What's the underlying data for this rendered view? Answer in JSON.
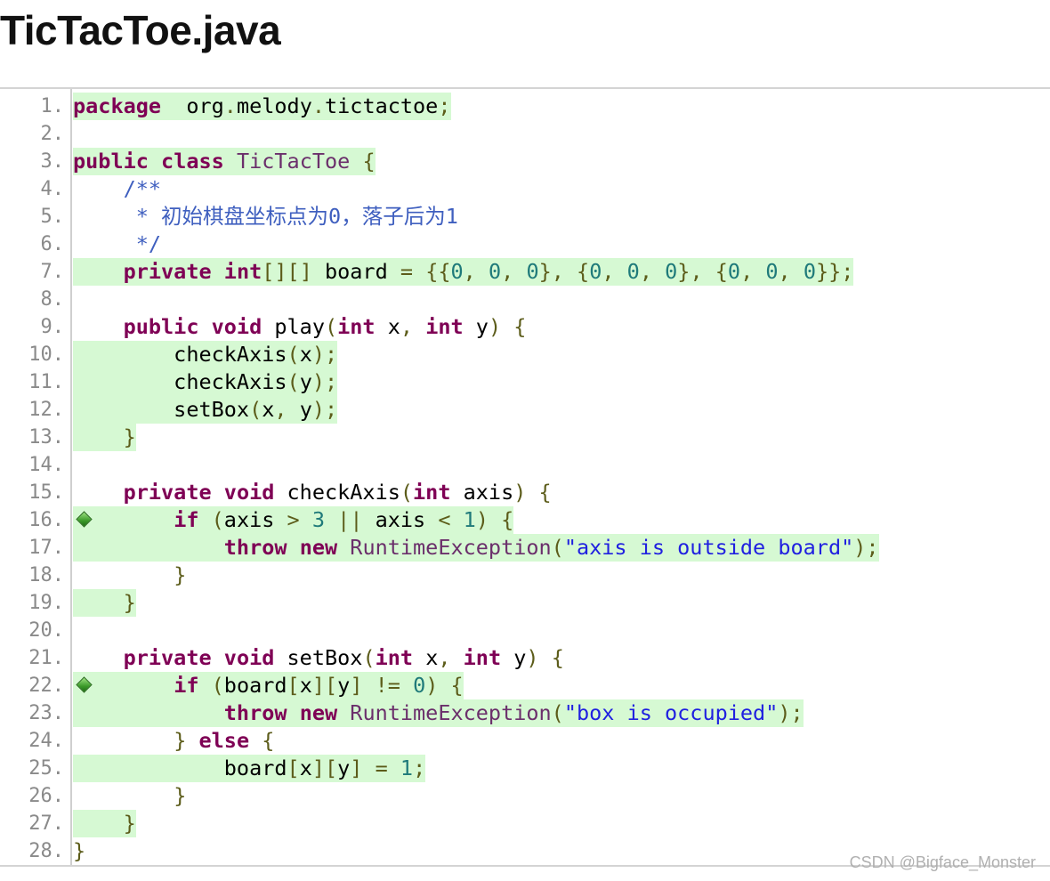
{
  "title": "TicTacToe.java",
  "watermark": "CSDN @Bigface_Monster",
  "colors": {
    "keyword": "#7f0055",
    "punct": "#5c5c1a",
    "string": "#2020e0",
    "number": "#1f7a7a",
    "comment": "#3f5fbf",
    "hit_background": "#d6f9d3",
    "line_number": "#8a8a8a"
  },
  "lines": [
    {
      "n": "1.",
      "hit": true,
      "icon": null,
      "tokens": [
        [
          "kw",
          "package"
        ],
        [
          "",
          "  org"
        ],
        [
          "dot",
          "."
        ],
        [
          "",
          "melody"
        ],
        [
          "dot",
          "."
        ],
        [
          "",
          "tictactoe"
        ],
        [
          "pun",
          ";"
        ]
      ]
    },
    {
      "n": "2.",
      "hit": false,
      "icon": null,
      "tokens": []
    },
    {
      "n": "3.",
      "hit": true,
      "icon": null,
      "tokens": [
        [
          "kw",
          "public"
        ],
        [
          "",
          " "
        ],
        [
          "kw",
          "class"
        ],
        [
          "",
          " "
        ],
        [
          "cls",
          "TicTacToe"
        ],
        [
          "",
          " "
        ],
        [
          "pun",
          "{"
        ]
      ]
    },
    {
      "n": "4.",
      "hit": false,
      "icon": null,
      "tokens": [
        [
          "",
          "    "
        ],
        [
          "cmt",
          "/**"
        ]
      ]
    },
    {
      "n": "5.",
      "hit": false,
      "icon": null,
      "tokens": [
        [
          "",
          "     "
        ],
        [
          "cmt",
          "* 初始棋盘坐标点为0，落子后为1"
        ]
      ]
    },
    {
      "n": "6.",
      "hit": false,
      "icon": null,
      "tokens": [
        [
          "",
          "     "
        ],
        [
          "cmt",
          "*/"
        ]
      ]
    },
    {
      "n": "7.",
      "hit": true,
      "icon": null,
      "tokens": [
        [
          "",
          "    "
        ],
        [
          "kw",
          "private"
        ],
        [
          "",
          " "
        ],
        [
          "kw",
          "int"
        ],
        [
          "pun",
          "[][]"
        ],
        [
          "",
          " board "
        ],
        [
          "pun",
          "="
        ],
        [
          "",
          " "
        ],
        [
          "pun",
          "{{"
        ],
        [
          "num",
          "0"
        ],
        [
          "pun",
          ","
        ],
        [
          "",
          " "
        ],
        [
          "num",
          "0"
        ],
        [
          "pun",
          ","
        ],
        [
          "",
          " "
        ],
        [
          "num",
          "0"
        ],
        [
          "pun",
          "},"
        ],
        [
          "",
          " "
        ],
        [
          "pun",
          "{"
        ],
        [
          "num",
          "0"
        ],
        [
          "pun",
          ","
        ],
        [
          "",
          " "
        ],
        [
          "num",
          "0"
        ],
        [
          "pun",
          ","
        ],
        [
          "",
          " "
        ],
        [
          "num",
          "0"
        ],
        [
          "pun",
          "},"
        ],
        [
          "",
          " "
        ],
        [
          "pun",
          "{"
        ],
        [
          "num",
          "0"
        ],
        [
          "pun",
          ","
        ],
        [
          "",
          " "
        ],
        [
          "num",
          "0"
        ],
        [
          "pun",
          ","
        ],
        [
          "",
          " "
        ],
        [
          "num",
          "0"
        ],
        [
          "pun",
          "}};"
        ]
      ]
    },
    {
      "n": "8.",
      "hit": false,
      "icon": null,
      "tokens": []
    },
    {
      "n": "9.",
      "hit": false,
      "icon": null,
      "tokens": [
        [
          "",
          "    "
        ],
        [
          "kw",
          "public"
        ],
        [
          "",
          " "
        ],
        [
          "kw",
          "void"
        ],
        [
          "",
          " play"
        ],
        [
          "pun",
          "("
        ],
        [
          "kw",
          "int"
        ],
        [
          "",
          " x"
        ],
        [
          "pun",
          ","
        ],
        [
          "",
          " "
        ],
        [
          "kw",
          "int"
        ],
        [
          "",
          " y"
        ],
        [
          "pun",
          ")"
        ],
        [
          "",
          " "
        ],
        [
          "pun",
          "{"
        ]
      ]
    },
    {
      "n": "10.",
      "hit": true,
      "icon": null,
      "tokens": [
        [
          "",
          "        checkAxis"
        ],
        [
          "pun",
          "("
        ],
        [
          "",
          "x"
        ],
        [
          "pun",
          ");"
        ]
      ]
    },
    {
      "n": "11.",
      "hit": true,
      "icon": null,
      "tokens": [
        [
          "",
          "        checkAxis"
        ],
        [
          "pun",
          "("
        ],
        [
          "",
          "y"
        ],
        [
          "pun",
          ");"
        ]
      ]
    },
    {
      "n": "12.",
      "hit": true,
      "icon": null,
      "tokens": [
        [
          "",
          "        setBox"
        ],
        [
          "pun",
          "("
        ],
        [
          "",
          "x"
        ],
        [
          "pun",
          ","
        ],
        [
          "",
          " y"
        ],
        [
          "pun",
          ");"
        ]
      ]
    },
    {
      "n": "13.",
      "hit": true,
      "icon": null,
      "tokens": [
        [
          "",
          "    "
        ],
        [
          "pun",
          "}"
        ]
      ]
    },
    {
      "n": "14.",
      "hit": false,
      "icon": null,
      "tokens": []
    },
    {
      "n": "15.",
      "hit": false,
      "icon": null,
      "tokens": [
        [
          "",
          "    "
        ],
        [
          "kw",
          "private"
        ],
        [
          "",
          " "
        ],
        [
          "kw",
          "void"
        ],
        [
          "",
          " checkAxis"
        ],
        [
          "pun",
          "("
        ],
        [
          "kw",
          "int"
        ],
        [
          "",
          " axis"
        ],
        [
          "pun",
          ")"
        ],
        [
          "",
          " "
        ],
        [
          "pun",
          "{"
        ]
      ]
    },
    {
      "n": "16.",
      "hit": true,
      "icon": "branch-covered-icon",
      "tokens": [
        [
          "",
          "        "
        ],
        [
          "kw",
          "if"
        ],
        [
          "",
          " "
        ],
        [
          "pun",
          "("
        ],
        [
          "",
          "axis "
        ],
        [
          "pun",
          ">"
        ],
        [
          "",
          " "
        ],
        [
          "num",
          "3"
        ],
        [
          "",
          " "
        ],
        [
          "pun",
          "||"
        ],
        [
          "",
          " axis "
        ],
        [
          "pun",
          "<"
        ],
        [
          "",
          " "
        ],
        [
          "num",
          "1"
        ],
        [
          "pun",
          ")"
        ],
        [
          "",
          " "
        ],
        [
          "pun",
          "{"
        ]
      ]
    },
    {
      "n": "17.",
      "hit": true,
      "icon": null,
      "tokens": [
        [
          "",
          "            "
        ],
        [
          "kw",
          "throw"
        ],
        [
          "",
          " "
        ],
        [
          "kw",
          "new"
        ],
        [
          "",
          " "
        ],
        [
          "cls",
          "RuntimeException"
        ],
        [
          "pun",
          "("
        ],
        [
          "str",
          "\"axis is outside board\""
        ],
        [
          "pun",
          ");"
        ]
      ]
    },
    {
      "n": "18.",
      "hit": false,
      "icon": null,
      "tokens": [
        [
          "",
          "        "
        ],
        [
          "pun",
          "}"
        ]
      ]
    },
    {
      "n": "19.",
      "hit": true,
      "icon": null,
      "tokens": [
        [
          "",
          "    "
        ],
        [
          "pun",
          "}"
        ]
      ]
    },
    {
      "n": "20.",
      "hit": false,
      "icon": null,
      "tokens": []
    },
    {
      "n": "21.",
      "hit": false,
      "icon": null,
      "tokens": [
        [
          "",
          "    "
        ],
        [
          "kw",
          "private"
        ],
        [
          "",
          " "
        ],
        [
          "kw",
          "void"
        ],
        [
          "",
          " setBox"
        ],
        [
          "pun",
          "("
        ],
        [
          "kw",
          "int"
        ],
        [
          "",
          " x"
        ],
        [
          "pun",
          ","
        ],
        [
          "",
          " "
        ],
        [
          "kw",
          "int"
        ],
        [
          "",
          " y"
        ],
        [
          "pun",
          ")"
        ],
        [
          "",
          " "
        ],
        [
          "pun",
          "{"
        ]
      ]
    },
    {
      "n": "22.",
      "hit": true,
      "icon": "branch-covered-icon",
      "tokens": [
        [
          "",
          "        "
        ],
        [
          "kw",
          "if"
        ],
        [
          "",
          " "
        ],
        [
          "pun",
          "("
        ],
        [
          "",
          "board"
        ],
        [
          "pun",
          "["
        ],
        [
          "",
          "x"
        ],
        [
          "pun",
          "]["
        ],
        [
          "",
          "y"
        ],
        [
          "pun",
          "]"
        ],
        [
          "",
          " "
        ],
        [
          "pun",
          "!="
        ],
        [
          "",
          " "
        ],
        [
          "num",
          "0"
        ],
        [
          "pun",
          ")"
        ],
        [
          "",
          " "
        ],
        [
          "pun",
          "{"
        ]
      ]
    },
    {
      "n": "23.",
      "hit": true,
      "icon": null,
      "tokens": [
        [
          "",
          "            "
        ],
        [
          "kw",
          "throw"
        ],
        [
          "",
          " "
        ],
        [
          "kw",
          "new"
        ],
        [
          "",
          " "
        ],
        [
          "cls",
          "RuntimeException"
        ],
        [
          "pun",
          "("
        ],
        [
          "str",
          "\"box is occupied\""
        ],
        [
          "pun",
          ");"
        ]
      ]
    },
    {
      "n": "24.",
      "hit": false,
      "icon": null,
      "tokens": [
        [
          "",
          "        "
        ],
        [
          "pun",
          "}"
        ],
        [
          "",
          " "
        ],
        [
          "kw",
          "else"
        ],
        [
          "",
          " "
        ],
        [
          "pun",
          "{"
        ]
      ]
    },
    {
      "n": "25.",
      "hit": true,
      "icon": null,
      "tokens": [
        [
          "",
          "            board"
        ],
        [
          "pun",
          "["
        ],
        [
          "",
          "x"
        ],
        [
          "pun",
          "]["
        ],
        [
          "",
          "y"
        ],
        [
          "pun",
          "]"
        ],
        [
          "",
          " "
        ],
        [
          "pun",
          "="
        ],
        [
          "",
          " "
        ],
        [
          "num",
          "1"
        ],
        [
          "pun",
          ";"
        ]
      ]
    },
    {
      "n": "26.",
      "hit": false,
      "icon": null,
      "tokens": [
        [
          "",
          "        "
        ],
        [
          "pun",
          "}"
        ]
      ]
    },
    {
      "n": "27.",
      "hit": true,
      "icon": null,
      "tokens": [
        [
          "",
          "    "
        ],
        [
          "pun",
          "}"
        ]
      ]
    },
    {
      "n": "28.",
      "hit": false,
      "icon": null,
      "tokens": [
        [
          "pun",
          "}"
        ]
      ]
    }
  ]
}
